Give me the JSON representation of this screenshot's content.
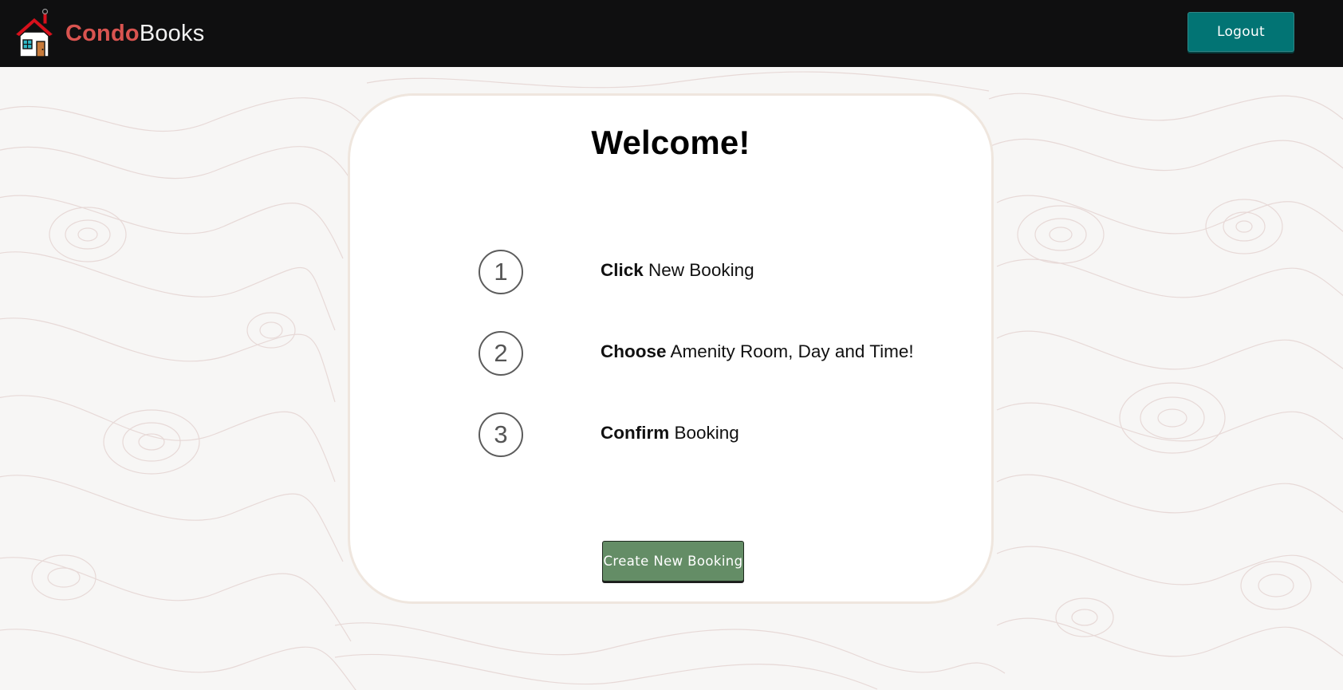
{
  "navbar": {
    "brand": {
      "part1": "Condo",
      "part2": "Books",
      "logo_icon": "house-icon"
    },
    "logout_label": "Logout"
  },
  "main": {
    "title": "Welcome!",
    "steps": [
      {
        "number": "1",
        "verb": "Click",
        "rest": " New Booking"
      },
      {
        "number": "2",
        "verb": "Choose",
        "rest": " Amenity Room, Day and Time!"
      },
      {
        "number": "3",
        "verb": "Confirm",
        "rest": " Booking"
      }
    ],
    "create_button_label": "Create New Booking"
  },
  "colors": {
    "navbar_bg": "#0f0f10",
    "brand_accent": "#d95450",
    "logout_bg": "#027474",
    "create_bg": "#648d66",
    "page_bg": "#f7f6f5"
  }
}
